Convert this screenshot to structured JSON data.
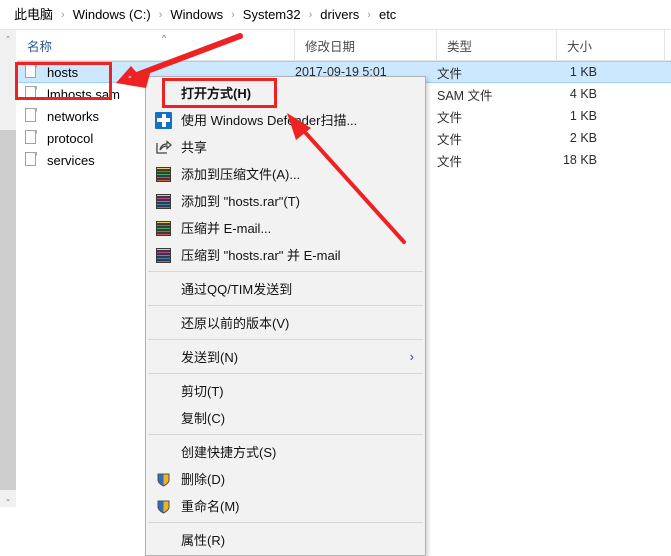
{
  "window": {
    "title": "etc",
    "breadcrumb": {
      "separator": "›",
      "items": [
        "此电脑",
        "Windows (C:)",
        "Windows",
        "System32",
        "drivers",
        "etc"
      ]
    }
  },
  "columns": [
    {
      "label": "名称",
      "sorted": true,
      "sort_direction": "ascending"
    },
    {
      "label": "修改日期",
      "sorted": false
    },
    {
      "label": "类型",
      "sorted": false
    },
    {
      "label": "大小",
      "sorted": false
    }
  ],
  "files": [
    {
      "name": "hosts",
      "date": "2017-09-19 5:01",
      "type": "文件",
      "size": "1 KB",
      "selected": true
    },
    {
      "name": "lmhosts.sam",
      "date": "",
      "type": "SAM 文件",
      "size": "4 KB",
      "selected": false
    },
    {
      "name": "networks",
      "date": "",
      "type": "文件",
      "size": "1 KB",
      "selected": false
    },
    {
      "name": "protocol",
      "date": "",
      "type": "文件",
      "size": "2 KB",
      "selected": false
    },
    {
      "name": "services",
      "date": "",
      "type": "文件",
      "size": "18 KB",
      "selected": false
    }
  ],
  "context_menu": {
    "items": [
      {
        "label": "打开方式(H)",
        "icon": "none",
        "bold": true,
        "submenu": false,
        "separator_after": false
      },
      {
        "label": "使用 Windows Defender扫描...",
        "icon": "defender-shield-icon",
        "bold": false,
        "submenu": false,
        "separator_after": false
      },
      {
        "label": "共享",
        "icon": "share-icon",
        "bold": false,
        "submenu": false,
        "separator_after": false
      },
      {
        "label": "添加到压缩文件(A)...",
        "icon": "winrar-icon",
        "bold": false,
        "submenu": false,
        "separator_after": false
      },
      {
        "label": "添加到 \"hosts.rar\"(T)",
        "icon": "winrar-icon",
        "bold": false,
        "submenu": false,
        "separator_after": false
      },
      {
        "label": "压缩并 E-mail...",
        "icon": "winrar-icon",
        "bold": false,
        "submenu": false,
        "separator_after": false
      },
      {
        "label": "压缩到 \"hosts.rar\" 并 E-mail",
        "icon": "winrar-icon",
        "bold": false,
        "submenu": false,
        "separator_after": true
      },
      {
        "label": "通过QQ/TIM发送到",
        "icon": "none",
        "bold": false,
        "submenu": false,
        "separator_after": true
      },
      {
        "label": "还原以前的版本(V)",
        "icon": "none",
        "bold": false,
        "submenu": false,
        "separator_after": true
      },
      {
        "label": "发送到(N)",
        "icon": "none",
        "bold": false,
        "submenu": true,
        "separator_after": true
      },
      {
        "label": "剪切(T)",
        "icon": "none",
        "bold": false,
        "submenu": false,
        "separator_after": false
      },
      {
        "label": "复制(C)",
        "icon": "none",
        "bold": false,
        "submenu": false,
        "separator_after": true
      },
      {
        "label": "创建快捷方式(S)",
        "icon": "none",
        "bold": false,
        "submenu": false,
        "separator_after": false
      },
      {
        "label": "删除(D)",
        "icon": "uac-shield-icon",
        "bold": false,
        "submenu": false,
        "separator_after": false
      },
      {
        "label": "重命名(M)",
        "icon": "uac-shield-icon",
        "bold": false,
        "submenu": false,
        "separator_after": true
      },
      {
        "label": "属性(R)",
        "icon": "none",
        "bold": false,
        "submenu": false,
        "separator_after": false
      }
    ],
    "submenu_arrow": "›"
  },
  "annotations": {
    "highlight_color": "#ee2222",
    "boxes": [
      {
        "name": "hosts-file-highlight"
      },
      {
        "name": "open-with-highlight"
      }
    ],
    "arrows": [
      {
        "name": "arrow-to-hosts-file"
      },
      {
        "name": "arrow-to-open-with"
      }
    ]
  },
  "scrollbar": {
    "up_arrow": "⌃",
    "down_arrow": "⌄"
  }
}
